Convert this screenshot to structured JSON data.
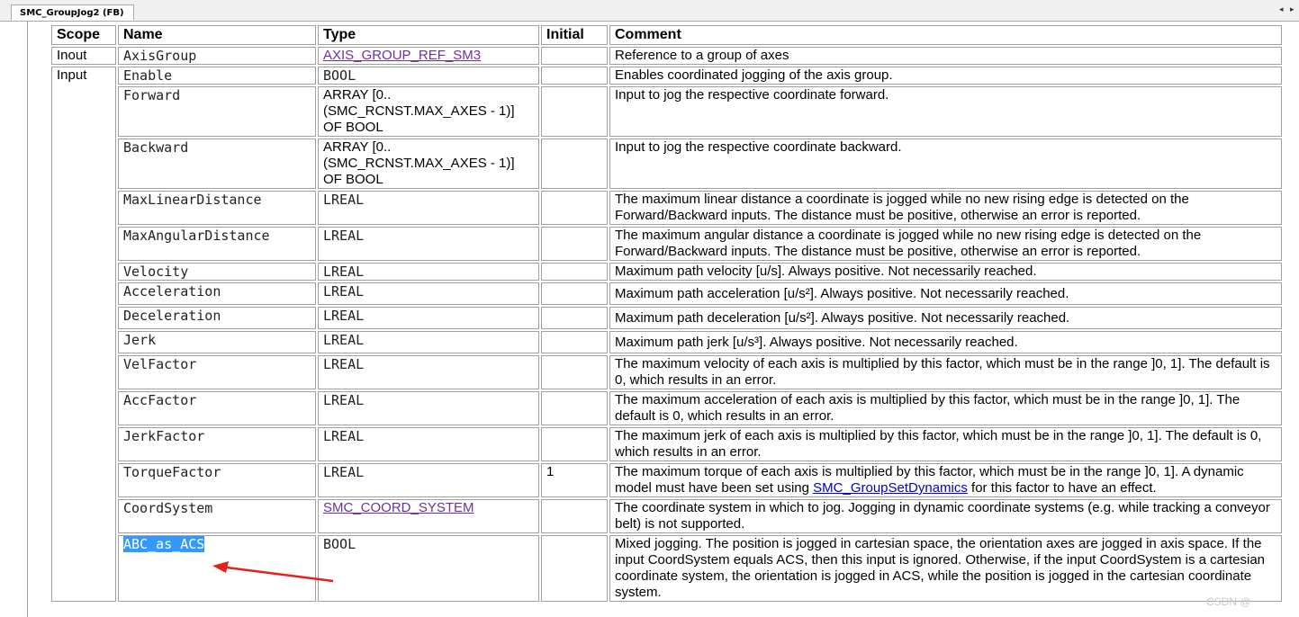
{
  "tab": {
    "title": "SMC_GroupJog2 (FB)"
  },
  "nav": {
    "left": "◂",
    "right": "▸"
  },
  "columns": {
    "scope": "Scope",
    "name": "Name",
    "type": "Type",
    "initial": "Initial",
    "comment": "Comment"
  },
  "rows": [
    {
      "scope": "Inout",
      "name": "AxisGroup",
      "type": "AXIS_GROUP_REF_SM3",
      "initial": "",
      "comment": "Reference to a group of axes"
    },
    {
      "scope": "Input",
      "name": "Enable",
      "type": "BOOL",
      "initial": "",
      "comment": "Enables coordinated jogging of the axis group."
    },
    {
      "name": "Forward",
      "type": "ARRAY [0..\n(SMC_RCNST.MAX_AXES - 1)]\nOF BOOL",
      "initial": "",
      "comment": "Input to jog the respective coordinate forward."
    },
    {
      "name": "Backward",
      "type": "ARRAY [0..\n(SMC_RCNST.MAX_AXES - 1)]\nOF BOOL",
      "initial": "",
      "comment": "Input to jog the respective coordinate backward."
    },
    {
      "name": "MaxLinearDistance",
      "type": "LREAL",
      "initial": "",
      "comment": "The maximum linear distance a coordinate is jogged while no new rising edge is detected on the Forward/Backward inputs. The distance must be positive, otherwise an error is reported."
    },
    {
      "name": "MaxAngularDistance",
      "type": "LREAL",
      "initial": "",
      "comment": "The maximum angular distance a coordinate is jogged while no new rising edge is detected on the Forward/Backward inputs. The distance must be positive, otherwise an error is reported."
    },
    {
      "name": "Velocity",
      "type": "LREAL",
      "initial": "",
      "comment": "Maximum path velocity [u/s]. Always positive. Not necessarily reached."
    },
    {
      "name": "Acceleration",
      "type": "LREAL",
      "initial": "",
      "comment": "Maximum path acceleration [u/s²]. Always positive. Not necessarily reached."
    },
    {
      "name": "Deceleration",
      "type": "LREAL",
      "initial": "",
      "comment": "Maximum path deceleration [u/s²]. Always positive. Not necessarily reached."
    },
    {
      "name": "Jerk",
      "type": "LREAL",
      "initial": "",
      "comment": "Maximum path jerk [u/s³]. Always positive. Not necessarily reached."
    },
    {
      "name": "VelFactor",
      "type": "LREAL",
      "initial": "",
      "comment": "The maximum velocity of each axis is multiplied by this factor, which must be in the range ]0, 1]. The default is 0, which results in an error."
    },
    {
      "name": "AccFactor",
      "type": "LREAL",
      "initial": "",
      "comment": "The maximum acceleration of each axis is multiplied by this factor, which must be in the range ]0, 1]. The default is 0, which results in an error."
    },
    {
      "name": "JerkFactor",
      "type": "LREAL",
      "initial": "",
      "comment": "The maximum jerk of each axis is multiplied by this factor, which must be in the range ]0, 1]. The default is 0, which results in an error."
    },
    {
      "name": "TorqueFactor",
      "type": "LREAL",
      "initial": "1",
      "comment_a": "The maximum torque of each axis is multiplied by this factor, which must be in the range ]0, 1]. A dynamic model must have been set using ",
      "comment_link": "SMC_GroupSetDynamics",
      "comment_b": " for this factor to have an effect."
    },
    {
      "name": "CoordSystem",
      "type": "SMC_COORD_SYSTEM",
      "initial": "",
      "comment": "The coordinate system in which to jog. Jogging in dynamic coordinate systems (e.g. while tracking a conveyor belt) is not supported."
    },
    {
      "name": "ABC_as_ACS",
      "type": "BOOL",
      "initial": "",
      "comment": "Mixed jogging. The position is jogged in cartesian space, the orientation axes are jogged in axis space. If the input CoordSystem equals ACS, then this input is ignored. Otherwise, if the input CoordSystem is a cartesian coordinate system, the orientation is jogged in ACS, while the position is jogged in the cartesian coordinate system."
    }
  ],
  "watermark": "CSDN @",
  "colors": {
    "selection": "#3399ff",
    "arrow": "#e8201a",
    "link": "#7030a0"
  }
}
